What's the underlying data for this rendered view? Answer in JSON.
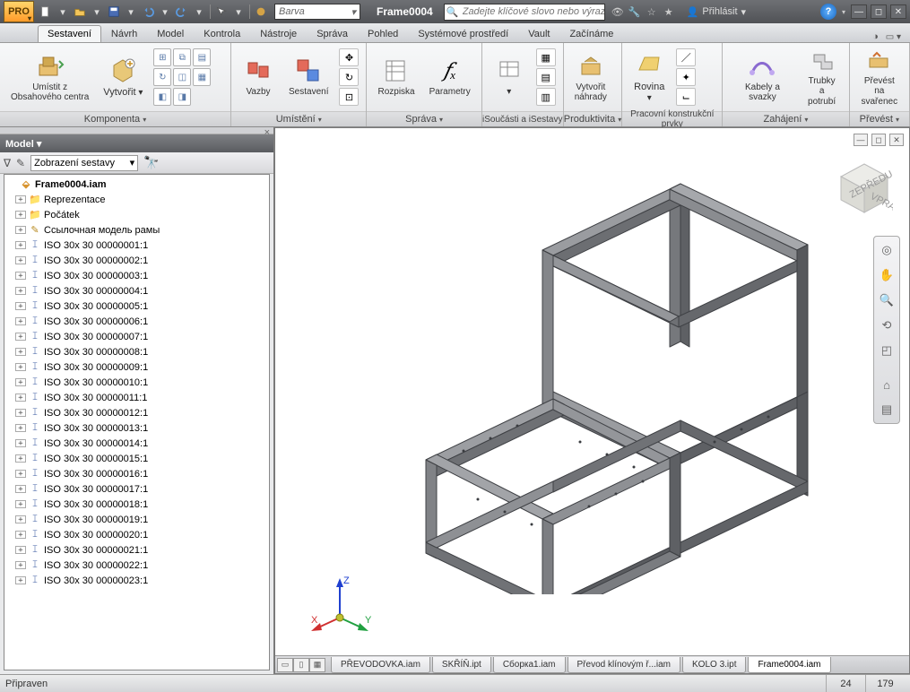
{
  "titlebar": {
    "logo_sub": "PRO",
    "color_label": "Barva",
    "doc_title": "Frame0004",
    "search_placeholder": "Zadejte klíčové slovo nebo výraz.",
    "signin": "Přihlásit"
  },
  "ribbon_tabs": [
    "Sestavení",
    "Návrh",
    "Model",
    "Kontrola",
    "Nástroje",
    "Správa",
    "Pohled",
    "Systémové prostředí",
    "Vault",
    "Začínáme"
  ],
  "ribbon_active": 0,
  "panels": {
    "komponenta": {
      "label": "Komponenta",
      "umistit": "Umístit z\nObsahového centra",
      "vytvorit": "Vytvořit"
    },
    "umisteni": {
      "label": "Umístění",
      "vazby": "Vazby",
      "sestaveni": "Sestavení"
    },
    "sprava": {
      "label": "Správa",
      "rozpiska": "Rozpiska",
      "parametry": "Parametry",
      "fx": "𝑓ₓ"
    },
    "isouc": {
      "label": "iSoučásti a iSestavy"
    },
    "produkt": {
      "label": "Produktivita",
      "vytvorit_nahrady": "Vytvořit\nnáhrady"
    },
    "prac": {
      "label": "Pracovní konstrukční prvky",
      "rovina": "Rovina"
    },
    "zahajeni": {
      "label": "Zahájení",
      "kabely": "Kabely a svazky",
      "trubky": "Trubky\na potrubí"
    },
    "prevest": {
      "label": "Převést",
      "prevest_svar": "Převést na\nsvařenec"
    }
  },
  "browser": {
    "title": "Model",
    "view_mode": "Zobrazení sestavy",
    "root": "Frame0004.iam",
    "top_nodes": [
      {
        "label": "Reprezentace",
        "icon": "fold"
      },
      {
        "label": "Počátek",
        "icon": "fold"
      },
      {
        "label": "Ссылочная модель рамы",
        "icon": "ref"
      }
    ],
    "parts_prefix": "ISO 30x 30 0000000",
    "parts_prefix2": "ISO 30x 30 000000",
    "parts_suffix": ":1",
    "parts_count": 23
  },
  "triad": {
    "x": "X",
    "y": "Y",
    "z": "Z"
  },
  "doc_tabs": [
    "PŘEVODOVKA.iam",
    "SKŘÍŇ.ipt",
    "Сборка1.iam",
    "Převod klínovým ř...iam",
    "KOLO 3.ipt",
    "Frame0004.iam"
  ],
  "doc_tab_active": 5,
  "status": {
    "text": "Připraven",
    "num1": "24",
    "num2": "179"
  }
}
